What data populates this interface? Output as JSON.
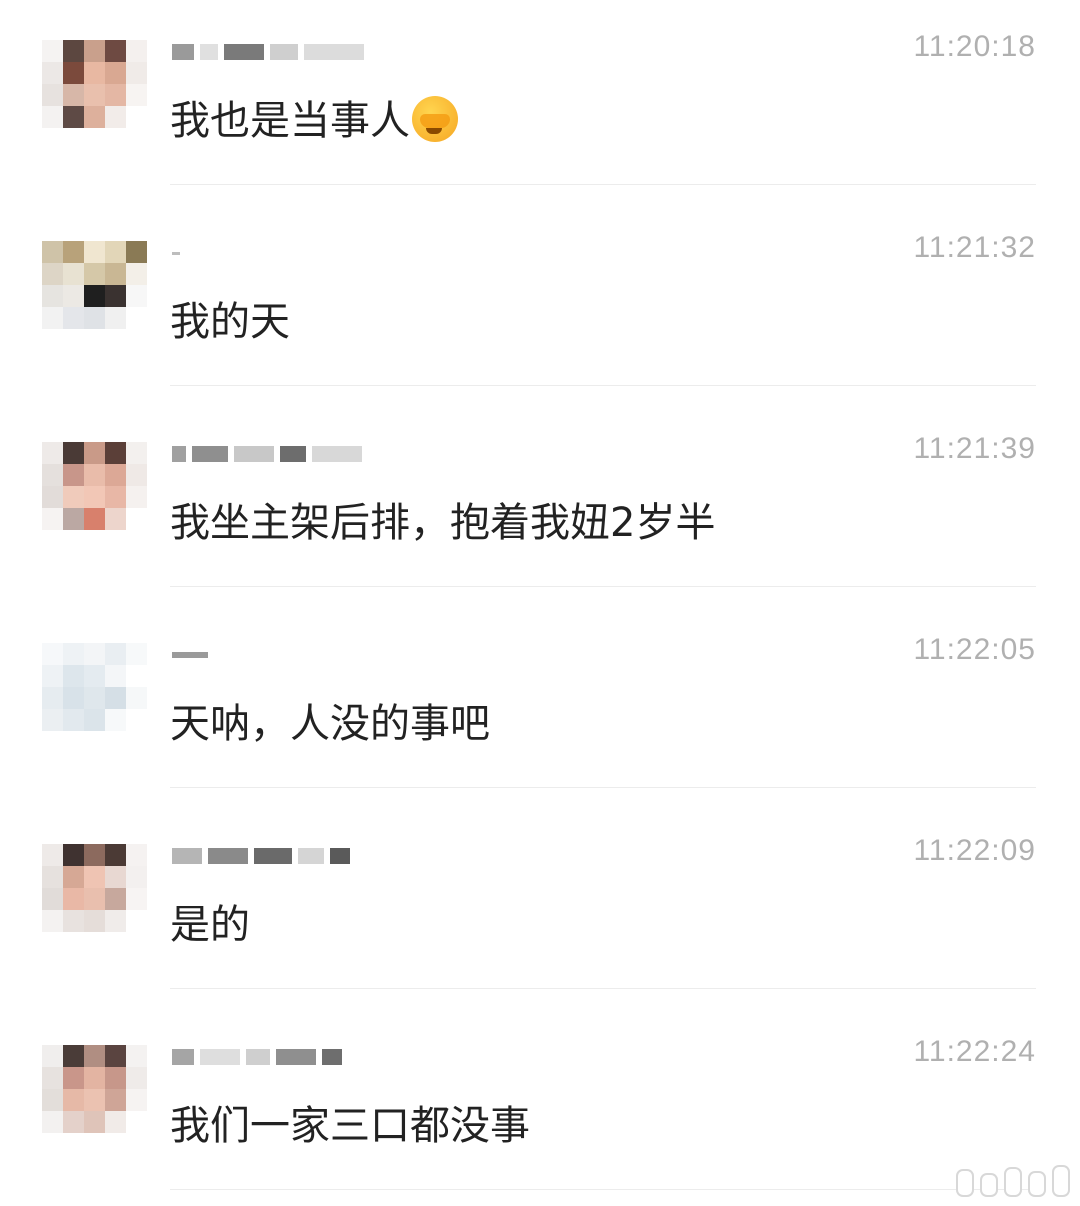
{
  "messages": [
    {
      "time": "11:20:18",
      "text": "我也是当事人",
      "emoji": "face-palm-emoji"
    },
    {
      "time": "11:21:32",
      "text": "我的天"
    },
    {
      "time": "11:21:39",
      "text": "我坐主架后排，抱着我妞2岁半"
    },
    {
      "time": "11:22:05",
      "text": "天呐，人没的事吧"
    },
    {
      "time": "11:22:09",
      "text": "是的"
    },
    {
      "time": "11:22:24",
      "text": "我们一家三口都没事"
    }
  ],
  "colors": {
    "time_text": "#b0b0b0",
    "message_text": "#222222",
    "divider": "#ececec"
  }
}
